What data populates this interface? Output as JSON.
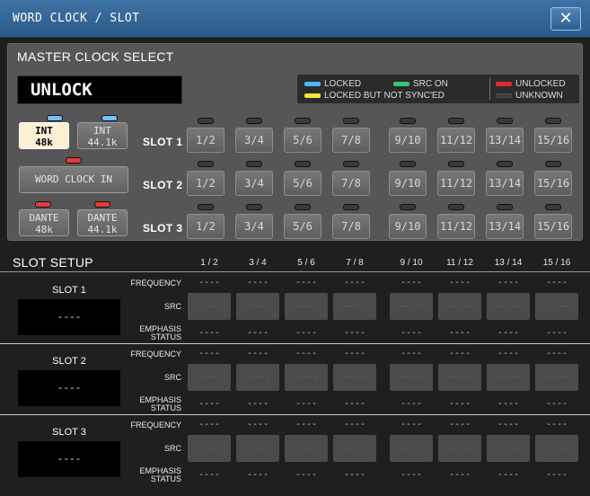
{
  "window": {
    "title": "WORD CLOCK / SLOT",
    "close_label": "✕"
  },
  "master": {
    "title": "MASTER CLOCK SELECT",
    "status": "UNLOCK",
    "legend": {
      "locked": "LOCKED",
      "src_on": "SRC ON",
      "unlocked": "UNLOCKED",
      "locked_not_synced": "LOCKED BUT NOT SYNC'ED",
      "unknown": "UNKNOWN",
      "colors": {
        "locked": "#4cb8ff",
        "src_on": "#3cc07a",
        "unlocked": "#e5282b",
        "locked_not_synced": "#f3e53a",
        "unknown": "#3a3a3a"
      }
    },
    "sources": [
      {
        "l1": "INT",
        "l2": "48k",
        "lamp": "blue",
        "selected": true
      },
      {
        "l1": "INT",
        "l2": "44.1k",
        "lamp": "blue",
        "selected": false
      },
      {
        "l1": "WORD CLOCK IN",
        "l2": "",
        "lamp": "red",
        "selected": false
      },
      {
        "l1": "DANTE",
        "l2": "48k",
        "lamp": "red",
        "selected": false
      },
      {
        "l1": "DANTE",
        "l2": "44.1k",
        "lamp": "red",
        "selected": false
      }
    ],
    "slots": [
      {
        "label": "SLOT 1",
        "channels": [
          "1/2",
          "3/4",
          "5/6",
          "7/8",
          "9/10",
          "11/12",
          "13/14",
          "15/16"
        ]
      },
      {
        "label": "SLOT 2",
        "channels": [
          "1/2",
          "3/4",
          "5/6",
          "7/8",
          "9/10",
          "11/12",
          "13/14",
          "15/16"
        ]
      },
      {
        "label": "SLOT 3",
        "channels": [
          "1/2",
          "3/4",
          "5/6",
          "7/8",
          "9/10",
          "11/12",
          "13/14",
          "15/16"
        ]
      }
    ]
  },
  "setup": {
    "title": "SLOT SETUP",
    "columns": [
      "1 / 2",
      "3 / 4",
      "5 / 6",
      "7 / 8",
      "9 / 10",
      "11 / 12",
      "13 / 14",
      "15 / 16"
    ],
    "row_labels": {
      "frequency": "FREQUENCY",
      "src": "SRC",
      "emphasis_1": "EMPHASIS",
      "emphasis_2": "STATUS"
    },
    "empty_value": "----",
    "src_value": "-----",
    "slots": [
      {
        "label": "SLOT 1",
        "value": "----"
      },
      {
        "label": "SLOT 2",
        "value": "----"
      },
      {
        "label": "SLOT 3",
        "value": "----"
      }
    ]
  }
}
